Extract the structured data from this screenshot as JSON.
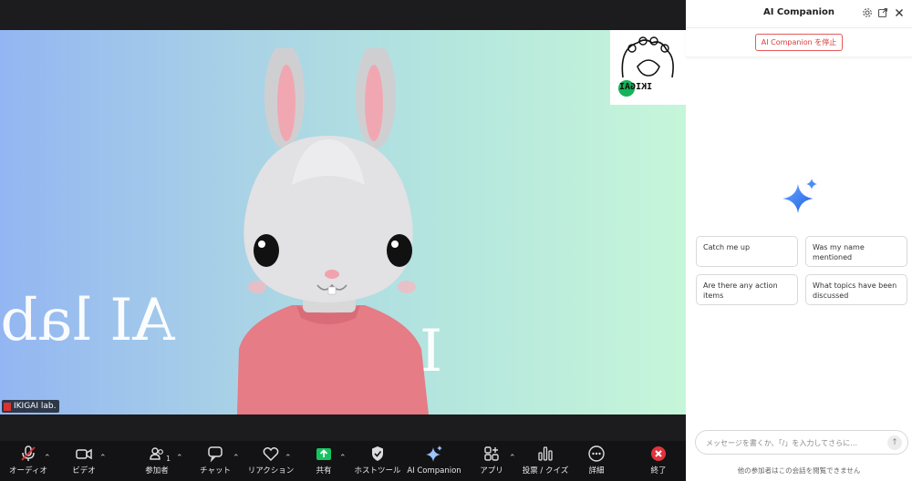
{
  "participant": {
    "name": "IKIGAI lab."
  },
  "background_text": {
    "line1": "I",
    "line2": "AI lab."
  },
  "logo": {
    "text": "IKIGAI"
  },
  "toolbar": {
    "audio": "オーディオ",
    "video": "ビデオ",
    "participants": "参加者",
    "participants_count": "1",
    "chat": "チャット",
    "reactions": "リアクション",
    "share": "共有",
    "host_tools": "ホストツール",
    "ai_companion": "AI Companion",
    "apps": "アプリ",
    "polls": "投票 / クイズ",
    "more": "詳細",
    "end": "終了"
  },
  "panel": {
    "title": "AI Companion",
    "stop_button": "AI Companion を停止",
    "suggestions": [
      "Catch me up",
      "Was my name mentioned",
      "Are there any action items",
      "What topics have been discussed"
    ],
    "input_placeholder": "メッセージを書くか、「/」を入力してさらに…",
    "footnote": "他の参加者はこの会話を閲覧できません"
  },
  "colors": {
    "accent": "#2d7cf6",
    "end": "#e0333a",
    "share": "#16c360"
  }
}
